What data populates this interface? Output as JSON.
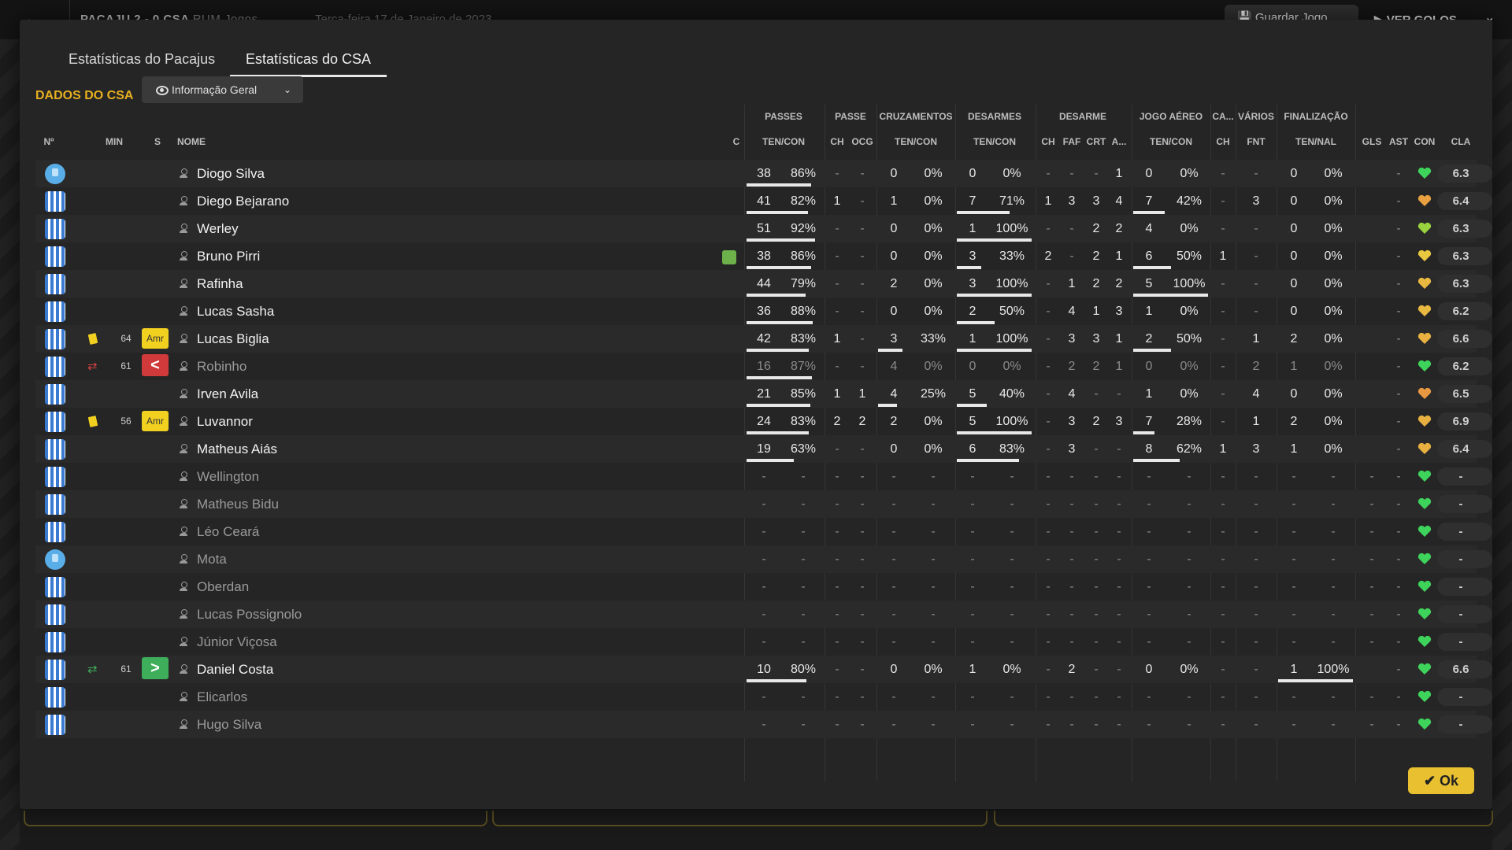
{
  "header": {
    "match": "PACAJU 2 - 0 CSA",
    "match_dim": "RUM Jogos",
    "date": "Terça-feira 17 de Janeiro de 2023",
    "save_label": "Guardar Jogo",
    "goals_label": "VER GOLOS"
  },
  "tabs": [
    {
      "label": "Estatísticas do Pacajus"
    },
    {
      "label": "Estatísticas do CSA"
    }
  ],
  "team_label": "DADOS DO CSA",
  "dropdown": {
    "label": "Informação Geral"
  },
  "groups": {
    "passes": "PASSES",
    "passe": "PASSE",
    "cruz": "CRUZAMENTOS",
    "desarmes": "DESARMES",
    "desarme": "DESARME",
    "aereo": "JOGO AÉREO",
    "ca": "CA...",
    "varios": "VÁRIOS",
    "final": "FINALIZAÇÃO"
  },
  "columns": {
    "num": "Nº",
    "min": "MIN",
    "s": "S",
    "nome": "NOME",
    "c": "C",
    "pass_tc": "TEN/CON",
    "ch1": "CH",
    "ocg": "OCG",
    "cruz_tc": "TEN/CON",
    "des_tc": "TEN/CON",
    "ch2": "CH",
    "faf": "FAF",
    "crt": "CRT",
    "a": "A...",
    "aer_tc": "TEN/CON",
    "ch3": "CH",
    "fnt": "FNT",
    "fin_tn": "TEN/NAL",
    "gls": "GLS",
    "ast": "AST",
    "con": "CON",
    "cla": "CLA"
  },
  "players": [
    {
      "name": "Diogo Silva",
      "shirt": "gk",
      "min": "",
      "s": "",
      "pt": "38",
      "pc": "86%",
      "pf": 0.86,
      "ch": "-",
      "ocg": "-",
      "ct": "0",
      "cc": "0%",
      "cf": 0,
      "dt": "0",
      "dc": "0%",
      "df": 0,
      "dch": "-",
      "faf": "-",
      "crt": "-",
      "a": "1",
      "at": "0",
      "ac": "0%",
      "af": 0,
      "ca": "-",
      "fnt": "-",
      "ft": "0",
      "fn": "0%",
      "ff": 0,
      "gls": "",
      "ast": "-",
      "cond": "#3ed35a",
      "cla": "6.3",
      "dim": false
    },
    {
      "name": "Diego Bejarano",
      "shirt": "st",
      "min": "",
      "s": "",
      "pt": "41",
      "pc": "82%",
      "pf": 0.82,
      "ch": "1",
      "ocg": "-",
      "ct": "1",
      "cc": "0%",
      "cf": 0,
      "dt": "7",
      "dc": "71%",
      "df": 0.71,
      "dch": "1",
      "faf": "3",
      "crt": "3",
      "a": "4",
      "at": "7",
      "ac": "42%",
      "af": 0.42,
      "ca": "-",
      "fnt": "3",
      "ft": "0",
      "fn": "0%",
      "ff": 0,
      "gls": "",
      "ast": "-",
      "cond": "#e8a040",
      "cla": "6.4",
      "dim": false
    },
    {
      "name": "Werley",
      "shirt": "st",
      "min": "",
      "s": "",
      "pt": "51",
      "pc": "92%",
      "pf": 0.92,
      "ch": "-",
      "ocg": "-",
      "ct": "0",
      "cc": "0%",
      "cf": 0,
      "dt": "1",
      "dc": "100%",
      "df": 1,
      "dch": "-",
      "faf": "-",
      "crt": "2",
      "a": "2",
      "at": "4",
      "ac": "0%",
      "af": 0,
      "ca": "-",
      "fnt": "-",
      "ft": "0",
      "fn": "0%",
      "ff": 0,
      "gls": "",
      "ast": "-",
      "cond": "#9ad33e",
      "cla": "6.3",
      "dim": false
    },
    {
      "name": "Bruno Pirri",
      "shirt": "st",
      "min": "",
      "s": "",
      "pt": "38",
      "pc": "86%",
      "pf": 0.86,
      "ch": "-",
      "ocg": "-",
      "ct": "0",
      "cc": "0%",
      "cf": 0,
      "dt": "3",
      "dc": "33%",
      "df": 0.33,
      "dch": "2",
      "faf": "-",
      "crt": "2",
      "a": "1",
      "at": "6",
      "ac": "50%",
      "af": 0.5,
      "ca": "1",
      "fnt": "-",
      "ft": "0",
      "fn": "0%",
      "ff": 0,
      "gls": "",
      "ast": "-",
      "cond": "#e8c840",
      "cla": "6.3",
      "dim": false,
      "condicon": true
    },
    {
      "name": "Rafinha",
      "shirt": "st",
      "min": "",
      "s": "",
      "pt": "44",
      "pc": "79%",
      "pf": 0.79,
      "ch": "-",
      "ocg": "-",
      "ct": "2",
      "cc": "0%",
      "cf": 0,
      "dt": "3",
      "dc": "100%",
      "df": 1,
      "dch": "-",
      "faf": "1",
      "crt": "2",
      "a": "2",
      "at": "5",
      "ac": "100%",
      "af": 1,
      "ca": "-",
      "fnt": "-",
      "ft": "0",
      "fn": "0%",
      "ff": 0,
      "gls": "",
      "ast": "-",
      "cond": "#e8b840",
      "cla": "6.3",
      "dim": false
    },
    {
      "name": "Lucas Sasha",
      "shirt": "st",
      "min": "",
      "s": "",
      "pt": "36",
      "pc": "88%",
      "pf": 0.88,
      "ch": "-",
      "ocg": "-",
      "ct": "0",
      "cc": "0%",
      "cf": 0,
      "dt": "2",
      "dc": "50%",
      "df": 0.5,
      "dch": "-",
      "faf": "4",
      "crt": "1",
      "a": "3",
      "at": "1",
      "ac": "0%",
      "af": 0,
      "ca": "-",
      "fnt": "-",
      "ft": "0",
      "fn": "0%",
      "ff": 0,
      "gls": "",
      "ast": "-",
      "cond": "#e8b840",
      "cla": "6.2",
      "dim": false
    },
    {
      "name": "Lucas Biglia",
      "shirt": "st",
      "min": "64",
      "s": "Amr",
      "card": "yellow",
      "pt": "42",
      "pc": "83%",
      "pf": 0.83,
      "ch": "1",
      "ocg": "-",
      "ct": "3",
      "cc": "33%",
      "cf": 0.33,
      "dt": "1",
      "dc": "100%",
      "df": 1,
      "dch": "-",
      "faf": "3",
      "crt": "3",
      "a": "1",
      "at": "2",
      "ac": "50%",
      "af": 0.5,
      "ca": "-",
      "fnt": "1",
      "ft": "2",
      "fn": "0%",
      "ff": 0,
      "gls": "",
      "ast": "-",
      "cond": "#e8b040",
      "cla": "6.6",
      "dim": false
    },
    {
      "name": "Robinho",
      "shirt": "st",
      "min": "61",
      "s": "<",
      "subtype": "out",
      "pt": "16",
      "pc": "87%",
      "pf": 0.87,
      "ch": "-",
      "ocg": "-",
      "ct": "4",
      "cc": "0%",
      "cf": 0,
      "dt": "0",
      "dc": "0%",
      "df": 0,
      "dch": "-",
      "faf": "2",
      "crt": "2",
      "a": "1",
      "at": "0",
      "ac": "0%",
      "af": 0,
      "ca": "-",
      "fnt": "2",
      "ft": "1",
      "fn": "0%",
      "ff": 0,
      "gls": "",
      "ast": "-",
      "cond": "#3ed35a",
      "cla": "6.2",
      "dim": true
    },
    {
      "name": "Irven Avila",
      "shirt": "st",
      "min": "",
      "s": "",
      "pt": "21",
      "pc": "85%",
      "pf": 0.85,
      "ch": "1",
      "ocg": "1",
      "ct": "4",
      "cc": "25%",
      "cf": 0.25,
      "dt": "5",
      "dc": "40%",
      "df": 0.4,
      "dch": "-",
      "faf": "4",
      "crt": "-",
      "a": "-",
      "at": "1",
      "ac": "0%",
      "af": 0,
      "ca": "-",
      "fnt": "4",
      "ft": "0",
      "fn": "0%",
      "ff": 0,
      "gls": "",
      "ast": "-",
      "cond": "#e89840",
      "cla": "6.5",
      "dim": false
    },
    {
      "name": "Luvannor",
      "shirt": "st",
      "min": "56",
      "s": "Amr",
      "card": "yellow",
      "pt": "24",
      "pc": "83%",
      "pf": 0.83,
      "ch": "2",
      "ocg": "2",
      "ct": "2",
      "cc": "0%",
      "cf": 0,
      "dt": "5",
      "dc": "100%",
      "df": 1,
      "dch": "-",
      "faf": "3",
      "crt": "2",
      "a": "3",
      "at": "7",
      "ac": "28%",
      "af": 0.28,
      "ca": "-",
      "fnt": "1",
      "ft": "2",
      "fn": "0%",
      "ff": 0,
      "gls": "",
      "ast": "-",
      "cond": "#e8b040",
      "cla": "6.9",
      "dim": false
    },
    {
      "name": "Matheus Aiás",
      "shirt": "st",
      "min": "",
      "s": "",
      "pt": "19",
      "pc": "63%",
      "pf": 0.63,
      "ch": "-",
      "ocg": "-",
      "ct": "0",
      "cc": "0%",
      "cf": 0,
      "dt": "6",
      "dc": "83%",
      "df": 0.83,
      "dch": "-",
      "faf": "3",
      "crt": "-",
      "a": "-",
      "at": "8",
      "ac": "62%",
      "af": 0.62,
      "ca": "1",
      "fnt": "3",
      "ft": "1",
      "fn": "0%",
      "ff": 0,
      "gls": "",
      "ast": "-",
      "cond": "#e8b040",
      "cla": "6.4",
      "dim": false
    },
    {
      "name": "Wellington",
      "shirt": "st",
      "empty": true,
      "cond": "#3ed35a",
      "cla": "-",
      "dim": true
    },
    {
      "name": "Matheus Bidu",
      "shirt": "st",
      "empty": true,
      "cond": "#3ed35a",
      "cla": "-",
      "dim": true
    },
    {
      "name": "Léo Ceará",
      "shirt": "st",
      "empty": true,
      "cond": "#3ed35a",
      "cla": "-",
      "dim": true
    },
    {
      "name": "Mota",
      "shirt": "gk",
      "empty": true,
      "cond": "#3ed35a",
      "cla": "-",
      "dim": true
    },
    {
      "name": "Oberdan",
      "shirt": "st",
      "empty": true,
      "cond": "#3ed35a",
      "cla": "-",
      "dim": true
    },
    {
      "name": "Lucas Possignolo",
      "shirt": "st",
      "empty": true,
      "cond": "#3ed35a",
      "cla": "-",
      "dim": true
    },
    {
      "name": "Júnior Viçosa",
      "shirt": "st",
      "empty": true,
      "cond": "#3ed35a",
      "cla": "-",
      "dim": true
    },
    {
      "name": "Daniel Costa",
      "shirt": "st",
      "min": "61",
      "s": ">",
      "subtype": "in",
      "pt": "10",
      "pc": "80%",
      "pf": 0.8,
      "ch": "-",
      "ocg": "-",
      "ct": "0",
      "cc": "0%",
      "cf": 0,
      "dt": "1",
      "dc": "0%",
      "df": 0,
      "dch": "-",
      "faf": "2",
      "crt": "-",
      "a": "-",
      "at": "0",
      "ac": "0%",
      "af": 0,
      "ca": "-",
      "fnt": "-",
      "ft": "1",
      "fn": "100%",
      "ff": 1,
      "gls": "",
      "ast": "-",
      "cond": "#3ed35a",
      "cla": "6.6",
      "dim": false
    },
    {
      "name": "Elicarlos",
      "shirt": "st",
      "empty": true,
      "cond": "#3ed35a",
      "cla": "-",
      "dim": true
    },
    {
      "name": "Hugo Silva",
      "shirt": "st",
      "empty": true,
      "cond": "#3ed35a",
      "cla": "-",
      "dim": true
    }
  ],
  "ok_label": "Ok"
}
